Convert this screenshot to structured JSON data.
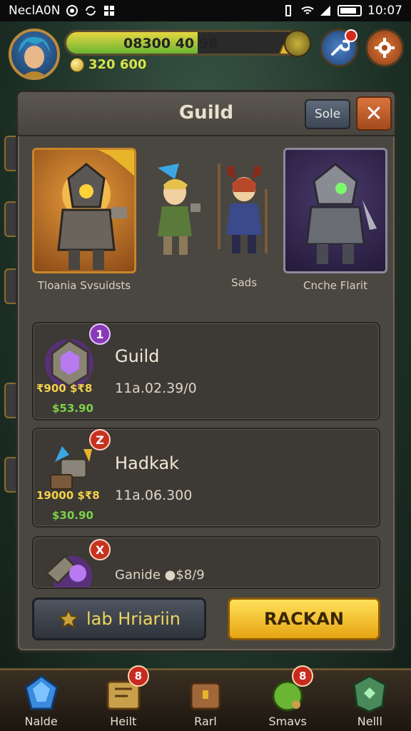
{
  "status_bar": {
    "left_text": "NeclA0N",
    "time": "10:07"
  },
  "hud": {
    "xp_text": "08300 40 98",
    "xp_progress": 0.55,
    "coins": "320 600"
  },
  "panel": {
    "title": "Guild",
    "sole_label": "Sole",
    "close_label": "✕"
  },
  "heroes": [
    {
      "label": "Tloania Svsuidsts"
    },
    {
      "label": ""
    },
    {
      "label": "Sads"
    },
    {
      "label": "Cnche Flarit"
    }
  ],
  "list": [
    {
      "rank": "1",
      "title": "Guild",
      "price": "₹900 $₹8",
      "sub": "$53.90",
      "value": "11a.02.39/0"
    },
    {
      "rank": "Z",
      "title": "Hadkak",
      "price": "19000 $₹8",
      "sub": "$30.90",
      "value": "11a.06.300"
    },
    {
      "rank": "X",
      "title": "",
      "price": "",
      "sub": "",
      "value": "Ganide ●$8/9"
    }
  ],
  "buttons": {
    "secondary_label": "lab Hriariin",
    "primary_label": "RACKAN"
  },
  "bottom_nav": [
    {
      "label": "Nalde",
      "badge": ""
    },
    {
      "label": "Heilt",
      "badge": "8"
    },
    {
      "label": "Rarl",
      "badge": ""
    },
    {
      "label": "Smavs",
      "badge": "8"
    },
    {
      "label": "Nelll",
      "badge": ""
    }
  ],
  "colors": {
    "panel_bg": "#4a4640",
    "primary_button": "#ffd23a",
    "accent_purple": "#8a3ab8",
    "accent_red": "#c7321f"
  }
}
